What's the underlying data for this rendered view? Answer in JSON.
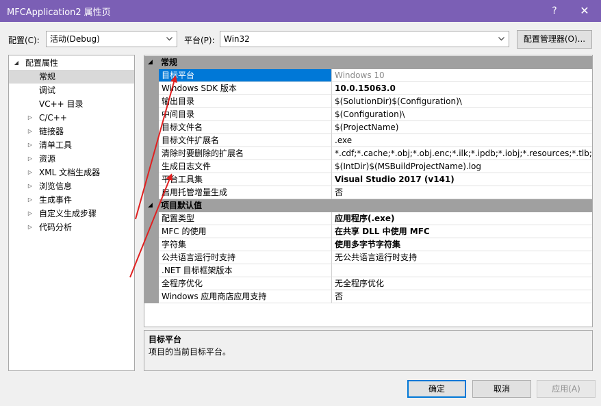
{
  "window": {
    "title": "MFCApplication2 属性页",
    "help": "?",
    "close": "✕"
  },
  "toolbar": {
    "config_label": "配置(C):",
    "config_value": "活动(Debug)",
    "platform_label": "平台(P):",
    "platform_value": "Win32",
    "config_manager": "配置管理器(O)..."
  },
  "tree": {
    "items": [
      {
        "label": "配置属性",
        "expander": "◢"
      },
      {
        "label": "常规",
        "expander": ""
      },
      {
        "label": "调试",
        "expander": ""
      },
      {
        "label": "VC++ 目录",
        "expander": ""
      },
      {
        "label": "C/C++",
        "expander": "▷"
      },
      {
        "label": "链接器",
        "expander": "▷"
      },
      {
        "label": "清单工具",
        "expander": "▷"
      },
      {
        "label": "资源",
        "expander": "▷"
      },
      {
        "label": "XML 文档生成器",
        "expander": "▷"
      },
      {
        "label": "浏览信息",
        "expander": "▷"
      },
      {
        "label": "生成事件",
        "expander": "▷"
      },
      {
        "label": "自定义生成步骤",
        "expander": "▷"
      },
      {
        "label": "代码分析",
        "expander": "▷"
      }
    ]
  },
  "grid": {
    "general": {
      "title": "常规",
      "toggle": "◢",
      "rows": [
        {
          "name": "目标平台",
          "value": "Windows 10"
        },
        {
          "name": "Windows SDK 版本",
          "value": "10.0.15063.0"
        },
        {
          "name": "输出目录",
          "value": "$(SolutionDir)$(Configuration)\\"
        },
        {
          "name": "中间目录",
          "value": "$(Configuration)\\"
        },
        {
          "name": "目标文件名",
          "value": "$(ProjectName)"
        },
        {
          "name": "目标文件扩展名",
          "value": ".exe"
        },
        {
          "name": "清除时要删除的扩展名",
          "value": "*.cdf;*.cache;*.obj;*.obj.enc;*.ilk;*.ipdb;*.iobj;*.resources;*.tlb;*.tli;*.t"
        },
        {
          "name": "生成日志文件",
          "value": "$(IntDir)$(MSBuildProjectName).log"
        },
        {
          "name": "平台工具集",
          "value": "Visual Studio 2017 (v141)"
        },
        {
          "name": "启用托管增量生成",
          "value": "否"
        }
      ]
    },
    "defaults": {
      "title": "项目默认值",
      "toggle": "◢",
      "rows": [
        {
          "name": "配置类型",
          "value": "应用程序(.exe)"
        },
        {
          "name": "MFC 的使用",
          "value": "在共享 DLL 中使用 MFC"
        },
        {
          "name": "字符集",
          "value": "使用多字节字符集"
        },
        {
          "name": "公共语言运行时支持",
          "value": "无公共语言运行时支持"
        },
        {
          "name": ".NET 目标框架版本",
          "value": ""
        },
        {
          "name": "全程序优化",
          "value": "无全程序优化"
        },
        {
          "name": "Windows 应用商店应用支持",
          "value": "否"
        }
      ]
    }
  },
  "description": {
    "title": "目标平台",
    "text": "项目的当前目标平台。"
  },
  "buttons": {
    "ok": "确定",
    "cancel": "取消",
    "apply": "应用(A)"
  },
  "colors": {
    "titlebar": "#7b5fb5",
    "selection": "#0078d7",
    "category": "#a0a0a0",
    "annotation": "#e02020"
  }
}
